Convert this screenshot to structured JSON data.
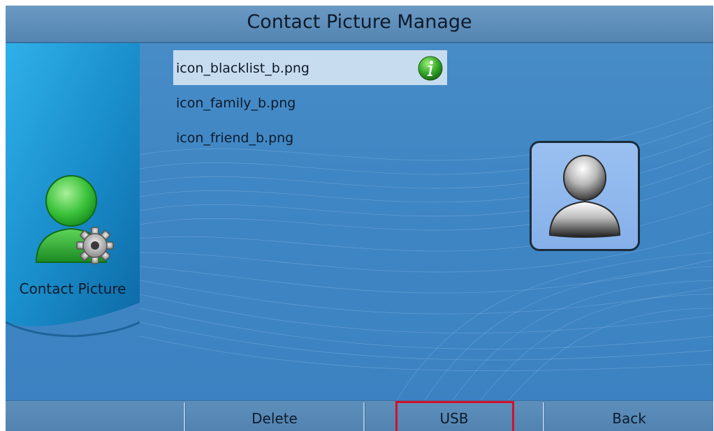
{
  "header": {
    "title": "Contact Picture Manage"
  },
  "sidebar": {
    "label": "Contact Picture",
    "icon": "contact-gear-icon"
  },
  "file_list": {
    "items": [
      {
        "name": "icon_blacklist_b.png",
        "selected": true
      },
      {
        "name": "icon_family_b.png",
        "selected": false
      },
      {
        "name": "icon_friend_b.png",
        "selected": false
      }
    ],
    "selected_badge_icon": "info-icon"
  },
  "preview": {
    "icon": "person-silhouette-icon"
  },
  "softkeys": {
    "key1": "",
    "key2": "Delete",
    "key3": "USB",
    "key4": "Back",
    "highlighted": "USB"
  },
  "colors": {
    "background": "#3f86c4",
    "header": "#5c8cb8",
    "selected_row": "#c8dcef",
    "highlight_border": "#d4102a",
    "preview_bg": "#8fb6ec"
  }
}
